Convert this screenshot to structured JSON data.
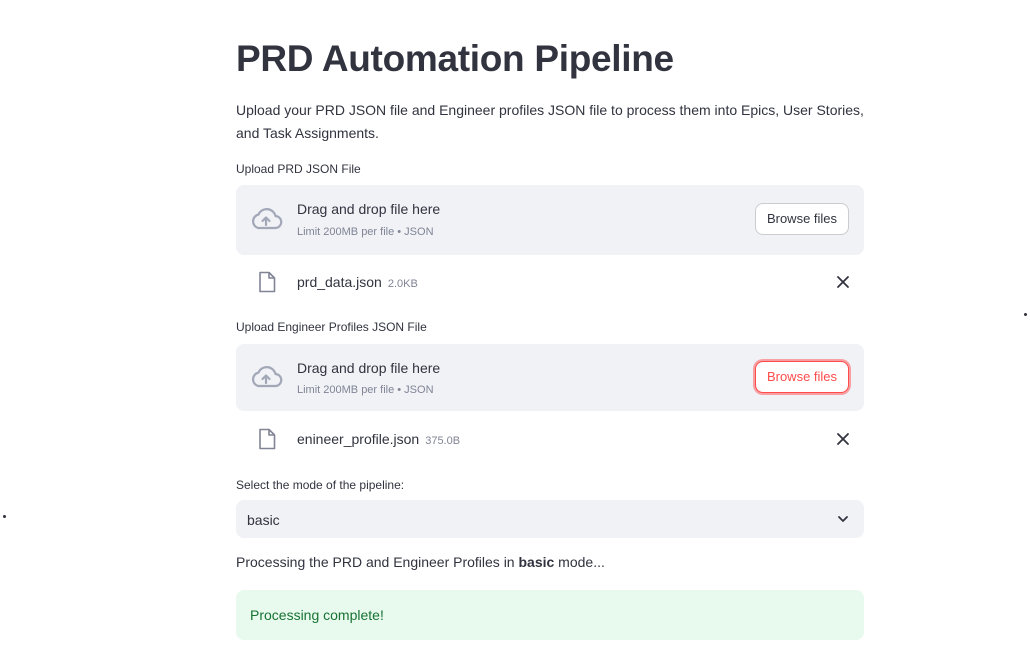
{
  "page": {
    "title": "PRD Automation Pipeline",
    "intro": "Upload your PRD JSON file and Engineer profiles JSON file to process them into Epics, User Stories, and Task Assignments."
  },
  "uploaders": [
    {
      "label": "Upload PRD JSON File",
      "drag_text": "Drag and drop file here",
      "limit_text": "Limit 200MB per file • JSON",
      "browse_label": "Browse files",
      "file": {
        "name": "prd_data.json",
        "size": "2.0KB"
      }
    },
    {
      "label": "Upload Engineer Profiles JSON File",
      "drag_text": "Drag and drop file here",
      "limit_text": "Limit 200MB per file • JSON",
      "browse_label": "Browse files",
      "file": {
        "name": "enineer_profile.json",
        "size": "375.0B"
      }
    }
  ],
  "mode_select": {
    "label": "Select the mode of the pipeline:",
    "value": "basic"
  },
  "status": {
    "prefix": "Processing the PRD and Engineer Profiles in ",
    "mode": "basic",
    "suffix": " mode...",
    "success": "Processing complete!"
  },
  "colors": {
    "text": "#31333f",
    "muted": "#808495",
    "widget_bg": "#f0f2f6",
    "accent": "#ff4b4b",
    "success_bg": "#e8f9ee",
    "success_text": "#177233"
  },
  "icons": {
    "upload": "cloud-upload-icon",
    "file": "file-icon",
    "remove": "close-icon",
    "dropdown": "chevron-down-icon"
  }
}
